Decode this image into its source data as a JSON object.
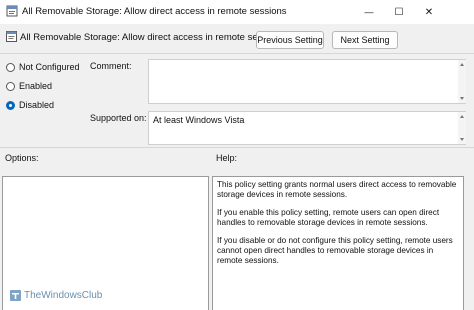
{
  "window": {
    "title": "All Removable Storage: Allow direct access in remote sessions",
    "minimize_glyph": "—",
    "maximize_glyph": "☐",
    "close_glyph": "✕"
  },
  "header": {
    "policy_name": "All Removable Storage: Allow direct access in remote sessions",
    "previous_label": "Previous Setting",
    "next_label": "Next Setting"
  },
  "state_options": [
    {
      "label": "Not Configured",
      "checked": false
    },
    {
      "label": "Enabled",
      "checked": false
    },
    {
      "label": "Disabled",
      "checked": true
    }
  ],
  "comment": {
    "label": "Comment:",
    "value": ""
  },
  "supported": {
    "label": "Supported on:",
    "value": "At least Windows Vista"
  },
  "options_label": "Options:",
  "help": {
    "label": "Help:",
    "paragraphs": [
      "This policy setting grants normal users direct access to removable storage devices in remote sessions.",
      "If you enable this policy setting, remote users can open direct handles to removable storage devices in remote sessions.",
      "If you disable or do not configure this policy setting, remote users cannot open direct handles to removable storage devices in remote sessions."
    ]
  },
  "watermark": "TheWindowsClub",
  "colors": {
    "accent": "#0067c0",
    "window_bg": "#f0f0f0"
  },
  "icons": [
    "policy-icon",
    "minimize-icon",
    "maximize-icon",
    "close-icon",
    "thewindowsclub-logo-icon"
  ]
}
